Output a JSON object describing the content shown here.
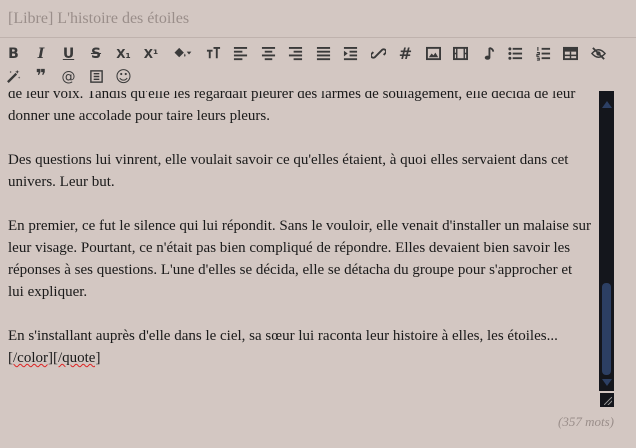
{
  "title": {
    "value": "[Libre] L'histoire des étoiles"
  },
  "toolbar": {
    "buttons": [
      {
        "name": "bold",
        "label": "B"
      },
      {
        "name": "italic",
        "label": "I"
      },
      {
        "name": "underline",
        "label": "U"
      },
      {
        "name": "strikethrough",
        "label": "S"
      },
      {
        "name": "subscript",
        "label": "X₁"
      },
      {
        "name": "superscript",
        "label": "X¹"
      },
      {
        "name": "fill-color",
        "label": ""
      },
      {
        "name": "font-size",
        "label": ""
      },
      {
        "name": "align-left",
        "label": ""
      },
      {
        "name": "align-center",
        "label": ""
      },
      {
        "name": "align-right",
        "label": ""
      },
      {
        "name": "justify",
        "label": ""
      },
      {
        "name": "indent",
        "label": ""
      },
      {
        "name": "link",
        "label": ""
      },
      {
        "name": "hashtag",
        "label": "#"
      },
      {
        "name": "image",
        "label": ""
      },
      {
        "name": "video",
        "label": ""
      },
      {
        "name": "music",
        "label": ""
      },
      {
        "name": "bullet-list",
        "label": ""
      },
      {
        "name": "numbered-list",
        "label": ""
      },
      {
        "name": "table",
        "label": ""
      },
      {
        "name": "hide",
        "label": ""
      },
      {
        "name": "magic-wand",
        "label": ""
      },
      {
        "name": "quote",
        "label": "❞"
      },
      {
        "name": "mention",
        "label": "@"
      },
      {
        "name": "spoiler",
        "label": ""
      },
      {
        "name": "emoji",
        "label": "☺"
      }
    ]
  },
  "editor": {
    "paragraphs": [
      "de leur voix. Tandis qu'elle les regardait pleurer des larmes de soulagement, elle décida de leur donner une accolade pour taire leurs pleurs.",
      "Des questions lui vinrent, elle voulait savoir ce qu'elles étaient, à quoi elles servaient dans cet univers. Leur but.",
      "En premier, ce fut le silence qui lui répondit. Sans le vouloir, elle venait d'installer un malaise sur leur visage. Pourtant, ce n'était pas bien compliqué de répondre. Elles devaient bien savoir les réponses à ses questions. L'une d'elles se décida, elle se détacha du groupe pour s'approcher et lui expliquer.",
      "En s'installant auprès d'elle dans le ciel, sa sœur lui raconta leur histoire à elles, les étoiles..."
    ],
    "closing_tags": "[/color][/quote]"
  },
  "word_count": "(357 mots)"
}
